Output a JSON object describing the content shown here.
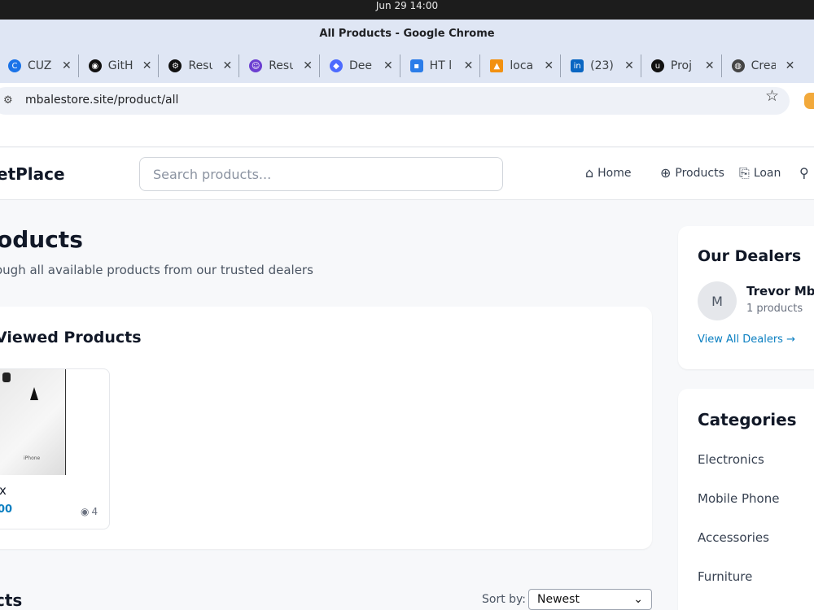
{
  "os": {
    "clock": "Jun 29  14:00"
  },
  "browser": {
    "window_title": "All Products - Google Chrome",
    "tabs": [
      {
        "label": "CUZ",
        "icon": "c-logo-icon",
        "color": "#1a73e8"
      },
      {
        "label": "GitH",
        "icon": "github-icon",
        "color": "#111111"
      },
      {
        "label": "Resu",
        "icon": "openai-icon",
        "color": "#111111"
      },
      {
        "label": "Resu",
        "icon": "smiley-icon",
        "color": "#6c3fd1"
      },
      {
        "label": "Dee",
        "icon": "deepseek-icon",
        "color": "#4d6bfe"
      },
      {
        "label": "HT l",
        "icon": "ht-icon",
        "color": "#2b7de9"
      },
      {
        "label": "loca",
        "icon": "pma-icon",
        "color": "#f29111"
      },
      {
        "label": "(23)",
        "icon": "linkedin-icon",
        "color": "#0a66c2"
      },
      {
        "label": "Proj",
        "icon": "upwork-icon",
        "color": "#111111"
      },
      {
        "label": "Crea",
        "icon": "globe-icon",
        "color": "#444444"
      }
    ],
    "url": "mbalestore.site/product/all"
  },
  "site": {
    "logo": "etPlace",
    "search_placeholder": "Search products...",
    "nav": {
      "home": "Home",
      "products": "Products",
      "loan": "Loan"
    }
  },
  "main": {
    "title": "oducts",
    "subtitle": "ough all available products from our trusted dealers",
    "recent_title": "Viewed Products",
    "recent_product": {
      "name": "x",
      "price": "00",
      "views": "4",
      "image_text": "iPhone"
    },
    "products_heading": "cts",
    "sort_label": "Sort by:",
    "sort_value": "Newest"
  },
  "sidebar": {
    "dealers_title": "Our Dealers",
    "dealer": {
      "initial": "M",
      "name": "Trevor Mba",
      "count": "1 products"
    },
    "view_all": "View All Dealers →",
    "categories_title": "Categories",
    "categories": [
      "Electronics",
      "Mobile Phone",
      "Accessories",
      "Furniture"
    ]
  }
}
